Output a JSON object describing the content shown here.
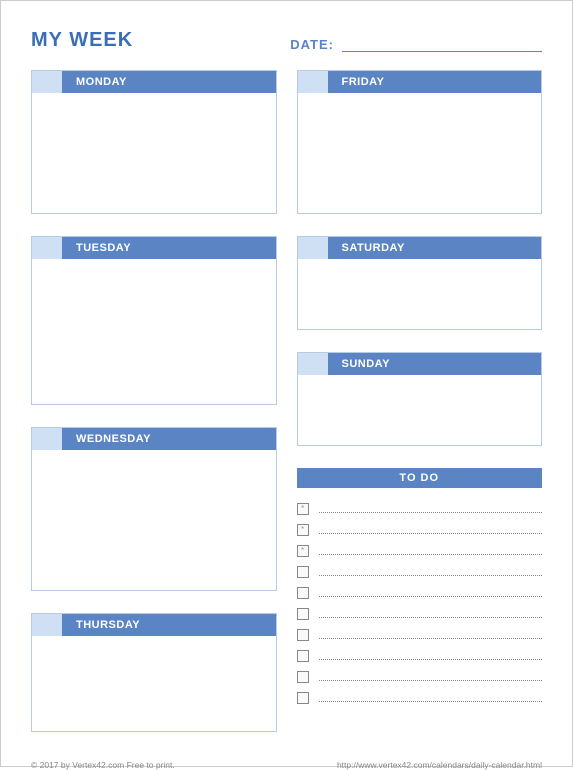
{
  "title": "MY WEEK",
  "date_label": "DATE:",
  "days": {
    "mon": "MONDAY",
    "tue": "TUESDAY",
    "wed": "WEDNESDAY",
    "thu": "THURSDAY",
    "fri": "FRIDAY",
    "sat": "SATURDAY",
    "sun": "SUNDAY"
  },
  "todo_label": "TO DO",
  "todo_marks": [
    "*",
    "*",
    "*",
    "",
    "",
    "",
    "",
    "",
    "",
    ""
  ],
  "footer_left": "© 2017 by Vertex42.com Free to print.",
  "footer_right": "http://www.vertex42.com/calendars/daily-calendar.html"
}
